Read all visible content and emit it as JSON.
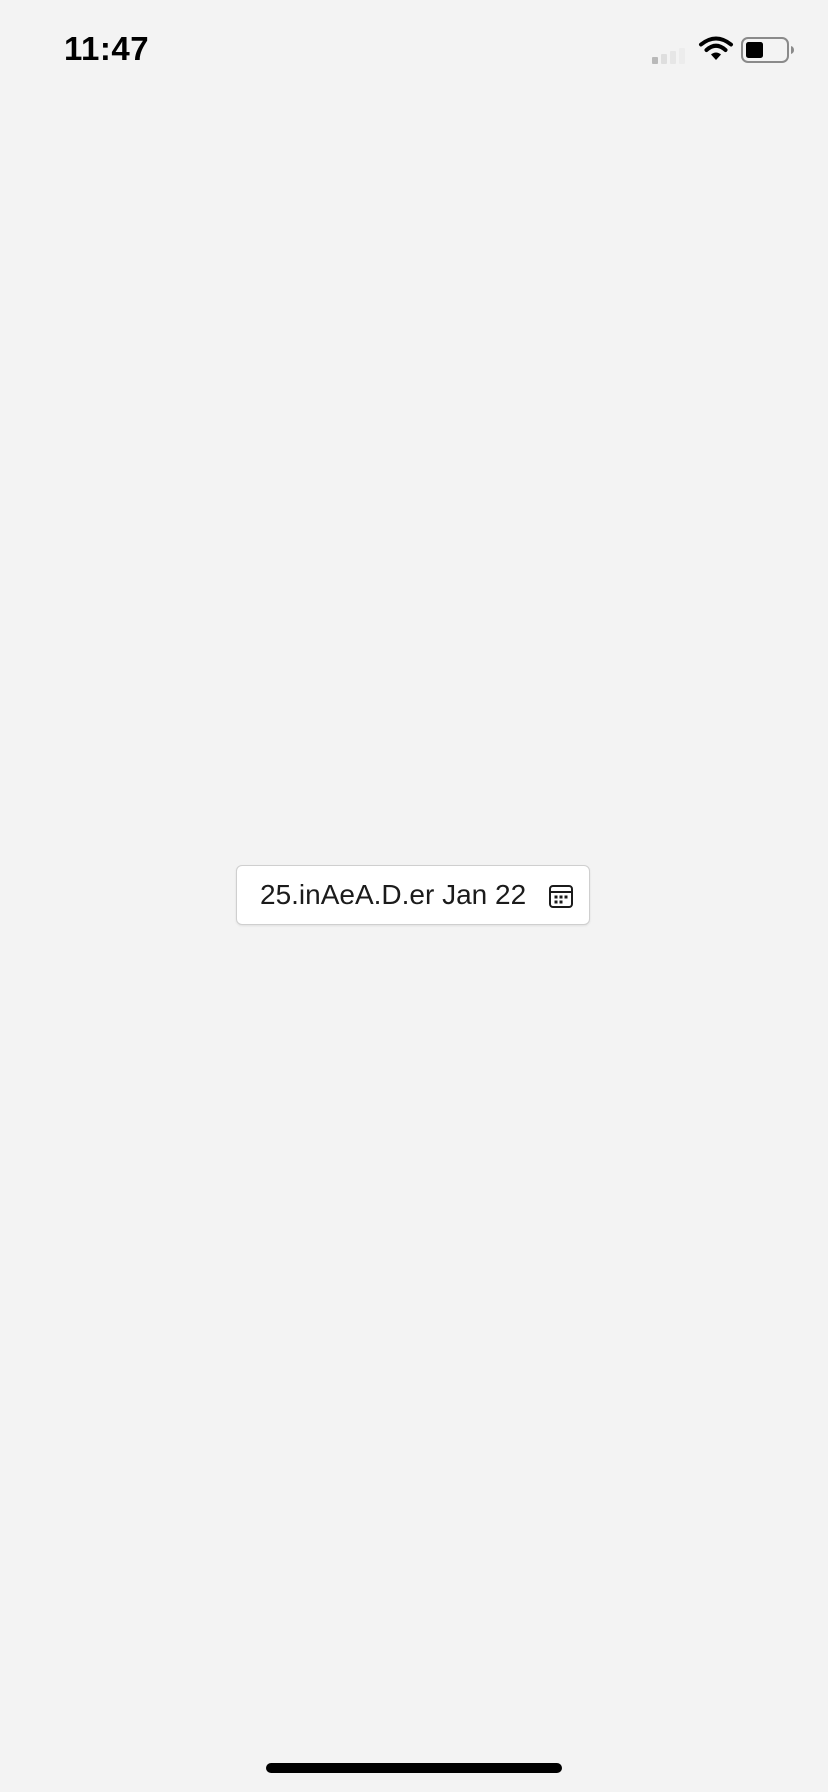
{
  "status_bar": {
    "time": "11:47",
    "icons": [
      "cellular-signal-icon",
      "wifi-icon",
      "battery-icon"
    ]
  },
  "date_picker": {
    "value": "25.inAeA.D.er Jan 22",
    "icon": "calendar-icon"
  },
  "colors": {
    "background": "#f3f3f3",
    "field_background": "#ffffff",
    "field_border": "#cfcfcf",
    "text": "#1b1b1b"
  }
}
